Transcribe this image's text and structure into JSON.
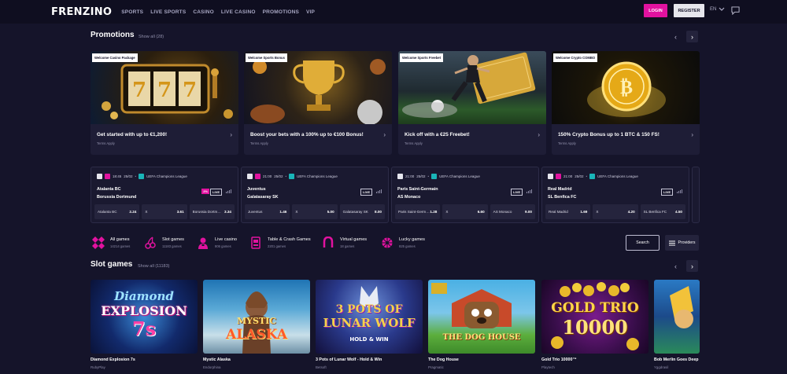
{
  "header": {
    "logo": "FRENZINO",
    "nav": [
      "SPORTS",
      "LIVE SPORTS",
      "CASINO",
      "LIVE CASINO",
      "PROMOTIONS",
      "VIP"
    ],
    "login": "LOGIN",
    "register": "REGISTER",
    "lang": "EN"
  },
  "promotions": {
    "title": "Promotions",
    "show_all": "Show all (28)",
    "cards": [
      {
        "tag": "Welcome Casino Package",
        "title": "Get started with up to €1,200!",
        "terms": "Terms Apply"
      },
      {
        "tag": "Welcome Sports Bonus",
        "title": "Boost your bets with a 100% up to €100 Bonus!",
        "terms": "Terms Apply"
      },
      {
        "tag": "Welcome Sports Freebet",
        "title": "Kick off with a €25 Freebet!",
        "terms": "Terms Apply"
      },
      {
        "tag": "Welcome Crypto COMBO",
        "title": "150% Crypto Bonus up to 1 BTC & 150 FS!",
        "terms": "Terms Apply"
      }
    ]
  },
  "matches": [
    {
      "time": "18:45",
      "date": "25/02",
      "league": "UEFA Champions League",
      "home": "Atalanta BC",
      "away": "Borussia Dortmund",
      "badge": "2%",
      "live": "LIVE",
      "odds": [
        {
          "label": "Atalanta BC",
          "value": "2.24"
        },
        {
          "label": "X",
          "value": "3.61"
        },
        {
          "label": "Borussia Dortm…",
          "value": "3.34"
        }
      ]
    },
    {
      "time": "21:00",
      "date": "25/02",
      "league": "UEFA Champions League",
      "home": "Juventus",
      "away": "Galatasaray SK",
      "badge": "",
      "live": "LIVE",
      "odds": [
        {
          "label": "Juventus",
          "value": "1.46"
        },
        {
          "label": "X",
          "value": "5.00"
        },
        {
          "label": "Galatasaray SK",
          "value": "8.00"
        }
      ]
    },
    {
      "time": "21:00",
      "date": "25/02",
      "league": "UEFA Champions League",
      "home": "Paris Saint-Germain",
      "away": "AS Monaco",
      "badge": "",
      "live": "LIVE",
      "odds": [
        {
          "label": "Paris Saint-Germ…",
          "value": "1.28"
        },
        {
          "label": "X",
          "value": "6.60"
        },
        {
          "label": "AS Monaco",
          "value": "9.00"
        }
      ]
    },
    {
      "time": "21:00",
      "date": "25/02",
      "league": "UEFA Champions League",
      "home": "Real Madrid",
      "away": "SL Benfica FC",
      "badge": "",
      "live": "LIVE",
      "odds": [
        {
          "label": "Real Madrid",
          "value": "1.69"
        },
        {
          "label": "X",
          "value": "4.20"
        },
        {
          "label": "SL Benfica FC",
          "value": "4.50"
        }
      ]
    }
  ],
  "categories": [
    {
      "label": "All games",
      "count": "14214 games",
      "icon": "all-games-icon"
    },
    {
      "label": "Slot games",
      "count": "11183 games",
      "icon": "cherries-icon"
    },
    {
      "label": "Live casino",
      "count": "806 games",
      "icon": "dealer-icon"
    },
    {
      "label": "Table & Crash Games",
      "count": "2201 games",
      "icon": "table-games-icon"
    },
    {
      "label": "Virtual games",
      "count": "18 games",
      "icon": "horseshoe-icon"
    },
    {
      "label": "Lucky games",
      "count": "825 games",
      "icon": "lucky-wheel-icon"
    }
  ],
  "search_label": "Search",
  "providers_label": "Providers",
  "slots": {
    "title": "Slot games",
    "show_all": "Show all (11183)",
    "games": [
      {
        "title": "Diamond Explosion 7s",
        "provider": "RubyPlay",
        "art": "Diamond EXPLOSION 7s"
      },
      {
        "title": "Mystic Alaska",
        "provider": "Endorphina",
        "art": "MYSTIC ALASKA"
      },
      {
        "title": "3 Pots of Lunar Wolf - Hold & Win",
        "provider": "Betsoft",
        "art": "3 POTS OF LUNAR WOLF"
      },
      {
        "title": "The Dog House",
        "provider": "Pragmatic",
        "art": "THE DOG HOUSE"
      },
      {
        "title": "Gold Trio 10000™",
        "provider": "Playtech",
        "art": "GOLD TRIO 10000"
      },
      {
        "title": "Bob Merlin Goes Deep",
        "provider": "Yggdrasil",
        "art": ""
      }
    ]
  },
  "colors": {
    "accent": "#e1129f",
    "background": "#15142a",
    "card": "#1e1d36",
    "teal": "#19b5b8"
  }
}
